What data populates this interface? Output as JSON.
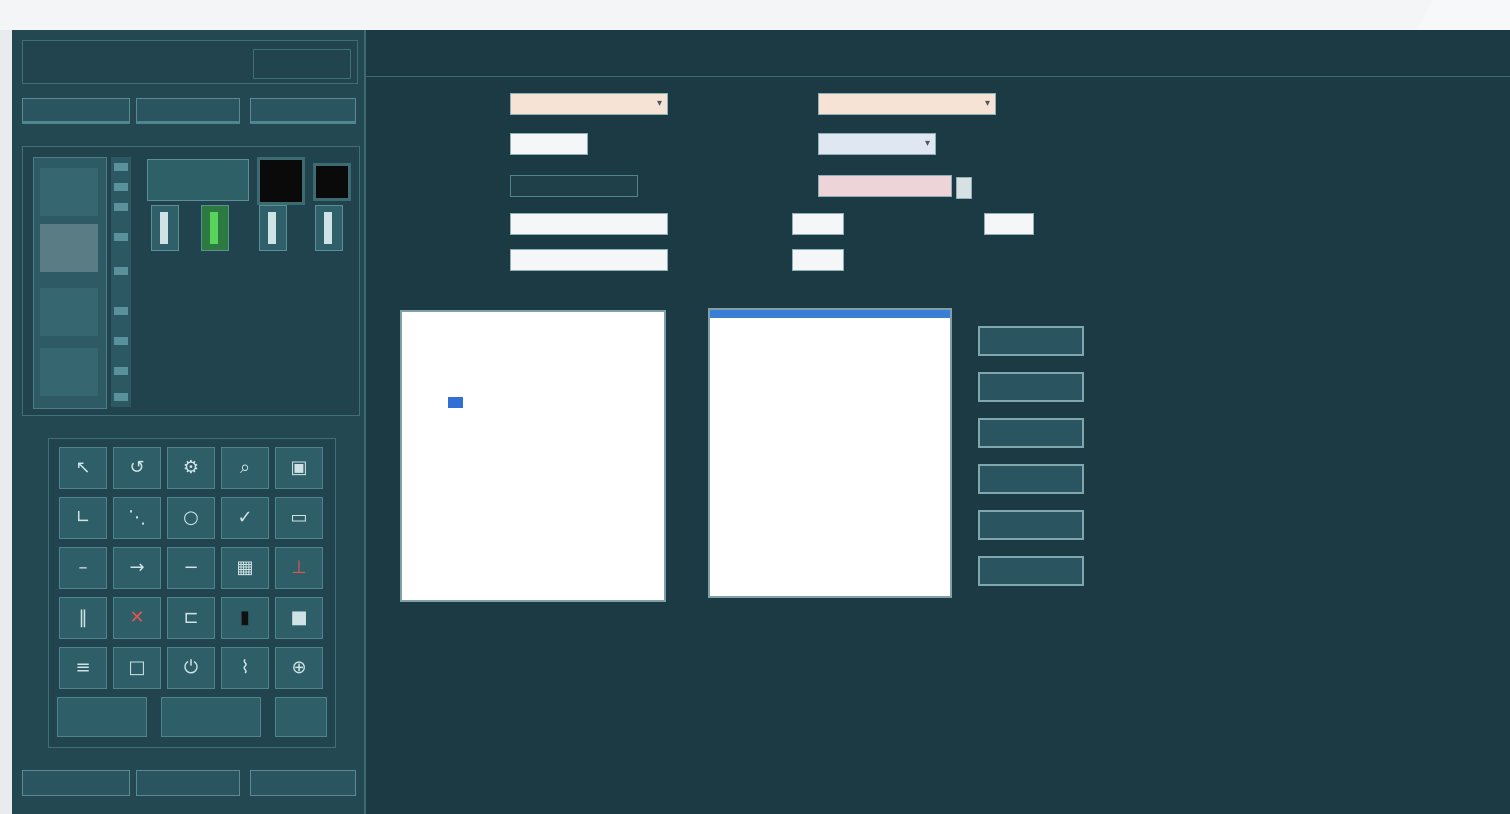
{
  "left_panel": {
    "title_line1": "",
    "title_line2": "",
    "tabs": [
      {
        "label": ""
      },
      {
        "label": ""
      },
      {
        "label": ""
      }
    ],
    "status_widget_text": "",
    "tool_icons": [
      "cursor-icon",
      "undo-icon",
      "gear-icon",
      "search-icon",
      "trash-icon",
      "line-icon",
      "node-icon",
      "circle-icon",
      "check-icon",
      "rect-icon",
      "dash-icon",
      "arrow-icon",
      "minus-icon",
      "grid-icon",
      "pin-icon",
      "bars-icon",
      "alert-icon",
      "bracket-icon",
      "lamp-icon",
      "stop-icon",
      "label-icon",
      "box-icon",
      "switch-icon",
      "link-icon",
      "zoom-icon"
    ],
    "bottom_buttons": [
      {
        "label": ""
      },
      {
        "label": ""
      },
      {
        "label": ""
      }
    ]
  },
  "header": {
    "col1_line1": "",
    "col1_line2": "",
    "col2_line1": "",
    "col2_line2": "",
    "col3_line1": "",
    "col3_line2": "",
    "col4_line1": "",
    "col4_line2": ""
  },
  "form": {
    "row1_label": "",
    "row1_value": "",
    "row1b_label": "",
    "row1b_value": "",
    "row2_label": "",
    "row2_value": "",
    "row2b_label": "",
    "row2b_value": "",
    "row3_label": "",
    "row3_value": "",
    "row3b_label": "",
    "row3b_value": "",
    "row4_label": "",
    "row4_value": "",
    "row4b_label": "",
    "row4b_value": "",
    "row4c_label": "",
    "row4c_value": "",
    "row4c_suffix": "",
    "row5_label": "",
    "row5_value": "",
    "row5b_label": "",
    "row5b_value": ""
  },
  "captions": {
    "tree": "",
    "list": ""
  },
  "tree": {
    "nodes": [
      "",
      "",
      "",
      "",
      "",
      "",
      "",
      "",
      "",
      "",
      "",
      "",
      "",
      "",
      "",
      "",
      "",
      "",
      "",
      "",
      "",
      "",
      ""
    ],
    "selected_index": 7
  },
  "actions": [
    {
      "label": ""
    },
    {
      "label": ""
    },
    {
      "label": ""
    },
    {
      "label": ""
    },
    {
      "label": ""
    },
    {
      "label": ""
    }
  ]
}
